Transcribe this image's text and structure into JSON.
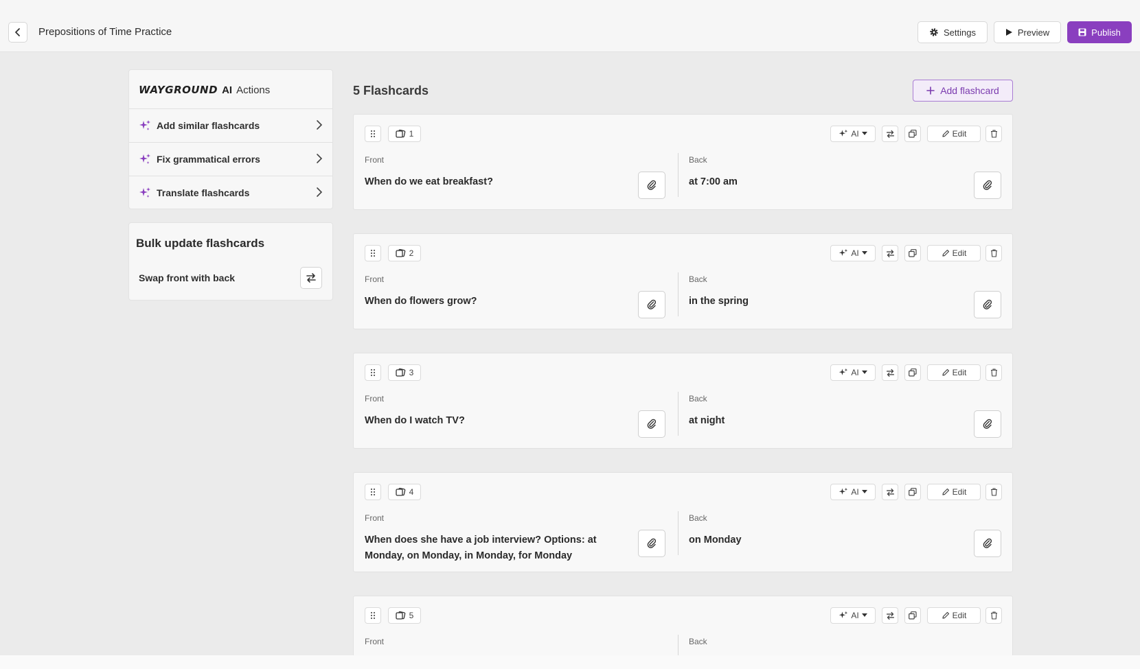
{
  "header": {
    "title": "Prepositions of Time Practice",
    "settings_label": "Settings",
    "preview_label": "Preview",
    "publish_label": "Publish"
  },
  "ai_panel": {
    "brand": "WAYGROUND",
    "brand_ai": "AI",
    "actions_label": "Actions",
    "items": [
      {
        "label": "Add similar flashcards"
      },
      {
        "label": "Fix grammatical errors"
      },
      {
        "label": "Translate flashcards"
      }
    ]
  },
  "bulk": {
    "title": "Bulk update flashcards",
    "swap_label": "Swap front with back"
  },
  "main": {
    "count_title": "5 Flashcards",
    "add_label": "Add flashcard",
    "front_label": "Front",
    "back_label": "Back",
    "ai_label": "AI",
    "edit_label": "Edit"
  },
  "cards": [
    {
      "num": "1",
      "front": "When do we eat breakfast?",
      "back": "at 7:00 am"
    },
    {
      "num": "2",
      "front": "When do flowers grow?",
      "back": "in the spring"
    },
    {
      "num": "3",
      "front": "When do I watch TV?",
      "back": "at night"
    },
    {
      "num": "4",
      "front": "When does she have a job interview? Options: at Monday, on Monday, in Monday, for Monday",
      "back": "on Monday"
    },
    {
      "num": "5",
      "front": "",
      "back": ""
    }
  ],
  "colors": {
    "accent": "#8a3fbf",
    "accent_light": "#f3ecf9",
    "background": "#ebebeb"
  },
  "icons": [
    "chevron-left-icon",
    "gear-icon",
    "play-icon",
    "save-icon",
    "sparkle-icon",
    "chevron-right-icon",
    "swap-icon",
    "plus-icon",
    "drag-handle-icon",
    "cards-icon",
    "copy-icon",
    "pencil-icon",
    "trash-icon",
    "paperclip-icon"
  ]
}
